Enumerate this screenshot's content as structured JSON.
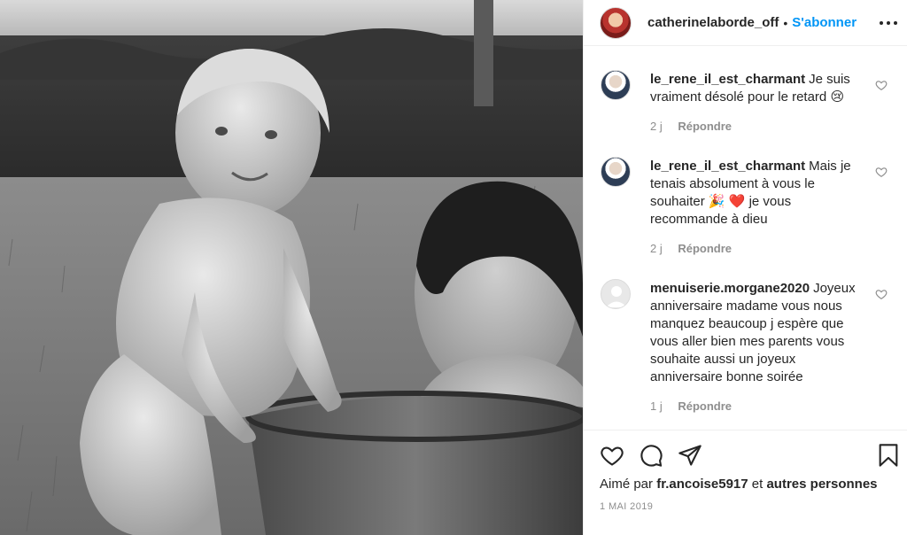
{
  "post": {
    "photo_alt": "Photo noir et blanc de deux enfants dans une bassine",
    "header": {
      "username": "catherinelaborde_off",
      "separator": "•",
      "follow_label": "S'abonner",
      "more_icon": "more-horizontal-icon"
    },
    "comments": [
      {
        "username": "le_rene_il_est_charmant",
        "text": "Je suis vraiment désolé pour le retard 😢",
        "time": "2 j",
        "reply_label": "Répondre"
      },
      {
        "username": "le_rene_il_est_charmant",
        "text": "Mais je tenais absolument à vous le souhaiter 🎉 ❤️  je vous recommande à dieu",
        "time": "2 j",
        "reply_label": "Répondre"
      },
      {
        "username": "menuiserie.morgane2020",
        "text": "Joyeux anniversaire madame vous nous manquez beaucoup j espère que vous aller bien mes parents vous souhaite aussi un joyeux anniversaire bonne soirée",
        "time": "1 j",
        "reply_label": "Répondre"
      }
    ],
    "actions": {
      "like_icon": "heart-icon",
      "comment_icon": "comment-icon",
      "share_icon": "share-icon",
      "save_icon": "bookmark-icon"
    },
    "likes": {
      "prefix": "Aimé par",
      "user": "fr.ancoise5917",
      "joiner": "et",
      "others": "autres personnes"
    },
    "date": "1 MAI 2019"
  },
  "colors": {
    "follow": "#0095f6",
    "text": "#262626",
    "muted": "#8e8e8e",
    "border": "#efefef"
  }
}
